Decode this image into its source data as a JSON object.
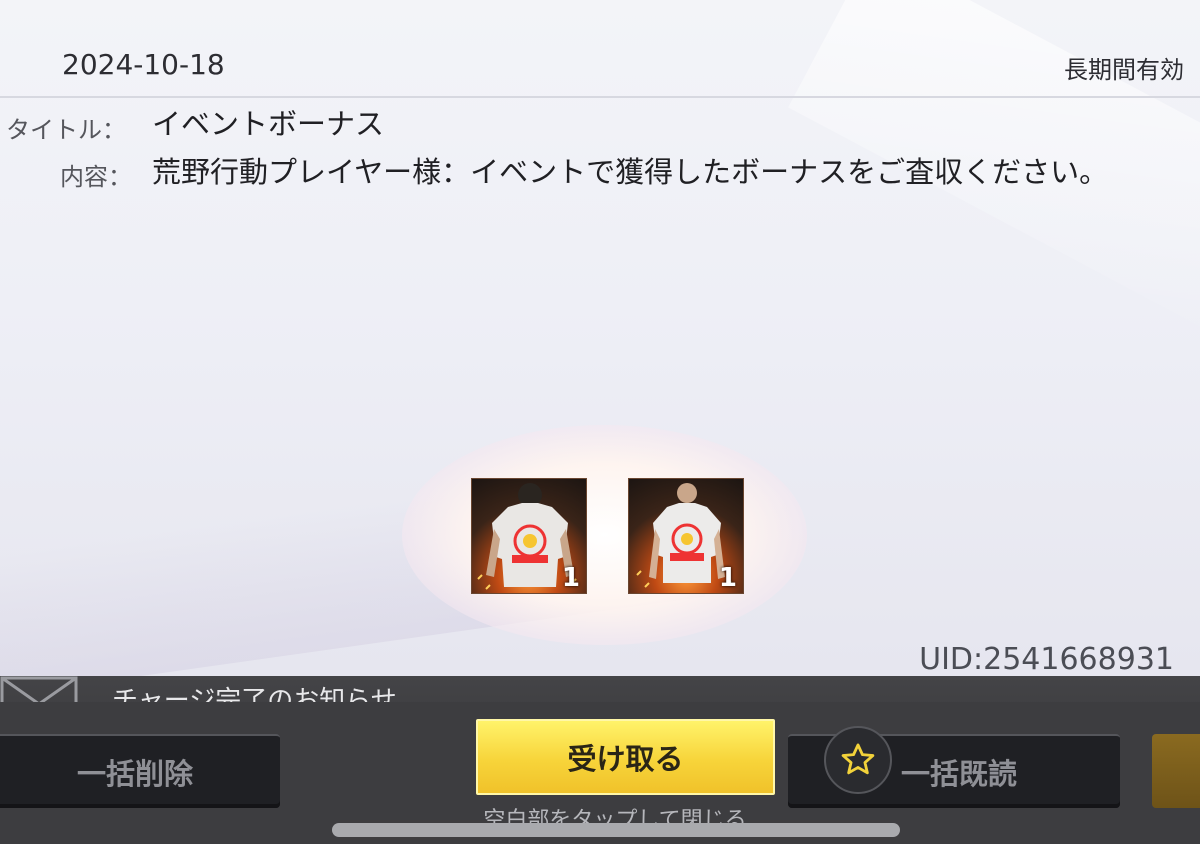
{
  "mail": {
    "date": "2024-10-18",
    "validity": "長期間有効",
    "title_label": "タイトル：",
    "title": "イベントボーナス",
    "content_label": "内容：",
    "content": "荒野行動プレイヤー様：イベントで獲得したボーナスをご査収ください。",
    "rewards": [
      {
        "icon": "tshirt-male-icon",
        "quantity": "1"
      },
      {
        "icon": "tshirt-female-icon",
        "quantity": "1"
      }
    ],
    "uid": "UID:2541668931"
  },
  "notice": {
    "text": "チャージ完了のお知らせ",
    "icon": "envelope-icon"
  },
  "actions": {
    "delete_all": "一括削除",
    "receive": "受け取る",
    "read_all": "一括既読",
    "favorite_icon": "star-icon"
  },
  "hint": "空白部をタップして閉じる",
  "colors": {
    "receive_button": "#f7d43a",
    "dark_button": "#1f2024",
    "panel_bg": "#eeeff6"
  }
}
